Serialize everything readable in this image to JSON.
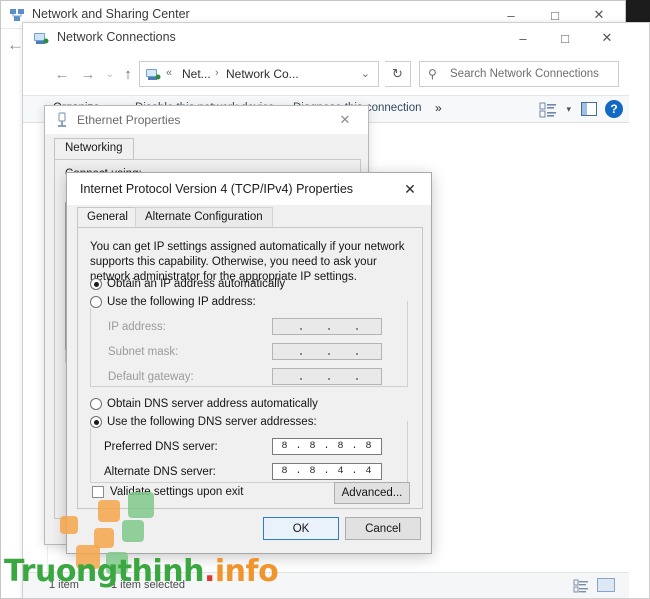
{
  "windows": {
    "network_sharing_center": {
      "title": "Network and Sharing Center",
      "icon": "network-sharing-icon",
      "controls": {
        "minimize": "–",
        "maximize": "□",
        "close": "✕"
      },
      "back_arrow": "←"
    },
    "network_connections": {
      "title": "Network Connections",
      "icon": "network-connections-icon",
      "controls": {
        "minimize": "–",
        "maximize": "□",
        "close": "✕"
      },
      "nav": {
        "back": "←",
        "forward": "→",
        "recent": "⌄",
        "up": "↑",
        "refresh": "↻"
      },
      "address": {
        "icon": "network-folder-icon",
        "overflow": "«",
        "crumb1": "Net...",
        "separator": "›",
        "crumb2": "Network Co...",
        "dropdown": "⌄"
      },
      "search": {
        "icon": "search-icon",
        "placeholder": "Search Network Connections"
      },
      "command_bar": {
        "organize": "Organize",
        "organize_arrow": "▾",
        "disable_device": "Disable this network device",
        "diagnose": "Diagnose this connection",
        "more": "»",
        "view_arrow": "▾",
        "help": "?"
      },
      "status_bar": {
        "item_count": "1 item",
        "selection": "1 item selected"
      }
    },
    "ethernet_properties": {
      "title": "Ethernet Properties",
      "icon": "ethernet-adapter-icon",
      "close": "✕",
      "tab": "Networking",
      "connect_using_label": "Connect using:"
    },
    "ipv4_properties": {
      "title": "Internet Protocol Version 4 (TCP/IPv4) Properties",
      "close": "✕",
      "tabs": [
        {
          "label": "General",
          "active": true
        },
        {
          "label": "Alternate Configuration",
          "active": false
        }
      ],
      "intro": "You can get IP settings assigned automatically if your network supports this capability. Otherwise, you need to ask your network administrator for the appropriate IP settings.",
      "ip_section": {
        "auto_option": "Obtain an IP address automatically",
        "auto_selected": true,
        "manual_option": "Use the following IP address:",
        "manual_selected": false,
        "fields": [
          {
            "label": "IP address:",
            "value": "",
            "disabled": true
          },
          {
            "label": "Subnet mask:",
            "value": "",
            "disabled": true
          },
          {
            "label": "Default gateway:",
            "value": "",
            "disabled": true
          }
        ]
      },
      "dns_section": {
        "auto_option": "Obtain DNS server address automatically",
        "auto_selected": false,
        "manual_option": "Use the following DNS server addresses:",
        "manual_selected": true,
        "fields": [
          {
            "label": "Preferred DNS server:",
            "value": "8 . 8 . 8 . 8",
            "disabled": false
          },
          {
            "label": "Alternate DNS server:",
            "value": "8 . 8 . 4 . 4",
            "disabled": false
          }
        ]
      },
      "validate_checkbox": {
        "label": "Validate settings upon exit",
        "checked": false
      },
      "advanced_button": "Advanced...",
      "ok_button": "OK",
      "cancel_button": "Cancel"
    }
  },
  "watermark": {
    "part1": "Truongthinh",
    "part2": "info",
    "dot": "."
  },
  "colors": {
    "accent_blue": "#2f7bc4",
    "help_blue": "#1268c3",
    "watermark_green": "#3aa741",
    "watermark_orange": "#f0952b",
    "dialog_face": "#f0f0f0"
  }
}
